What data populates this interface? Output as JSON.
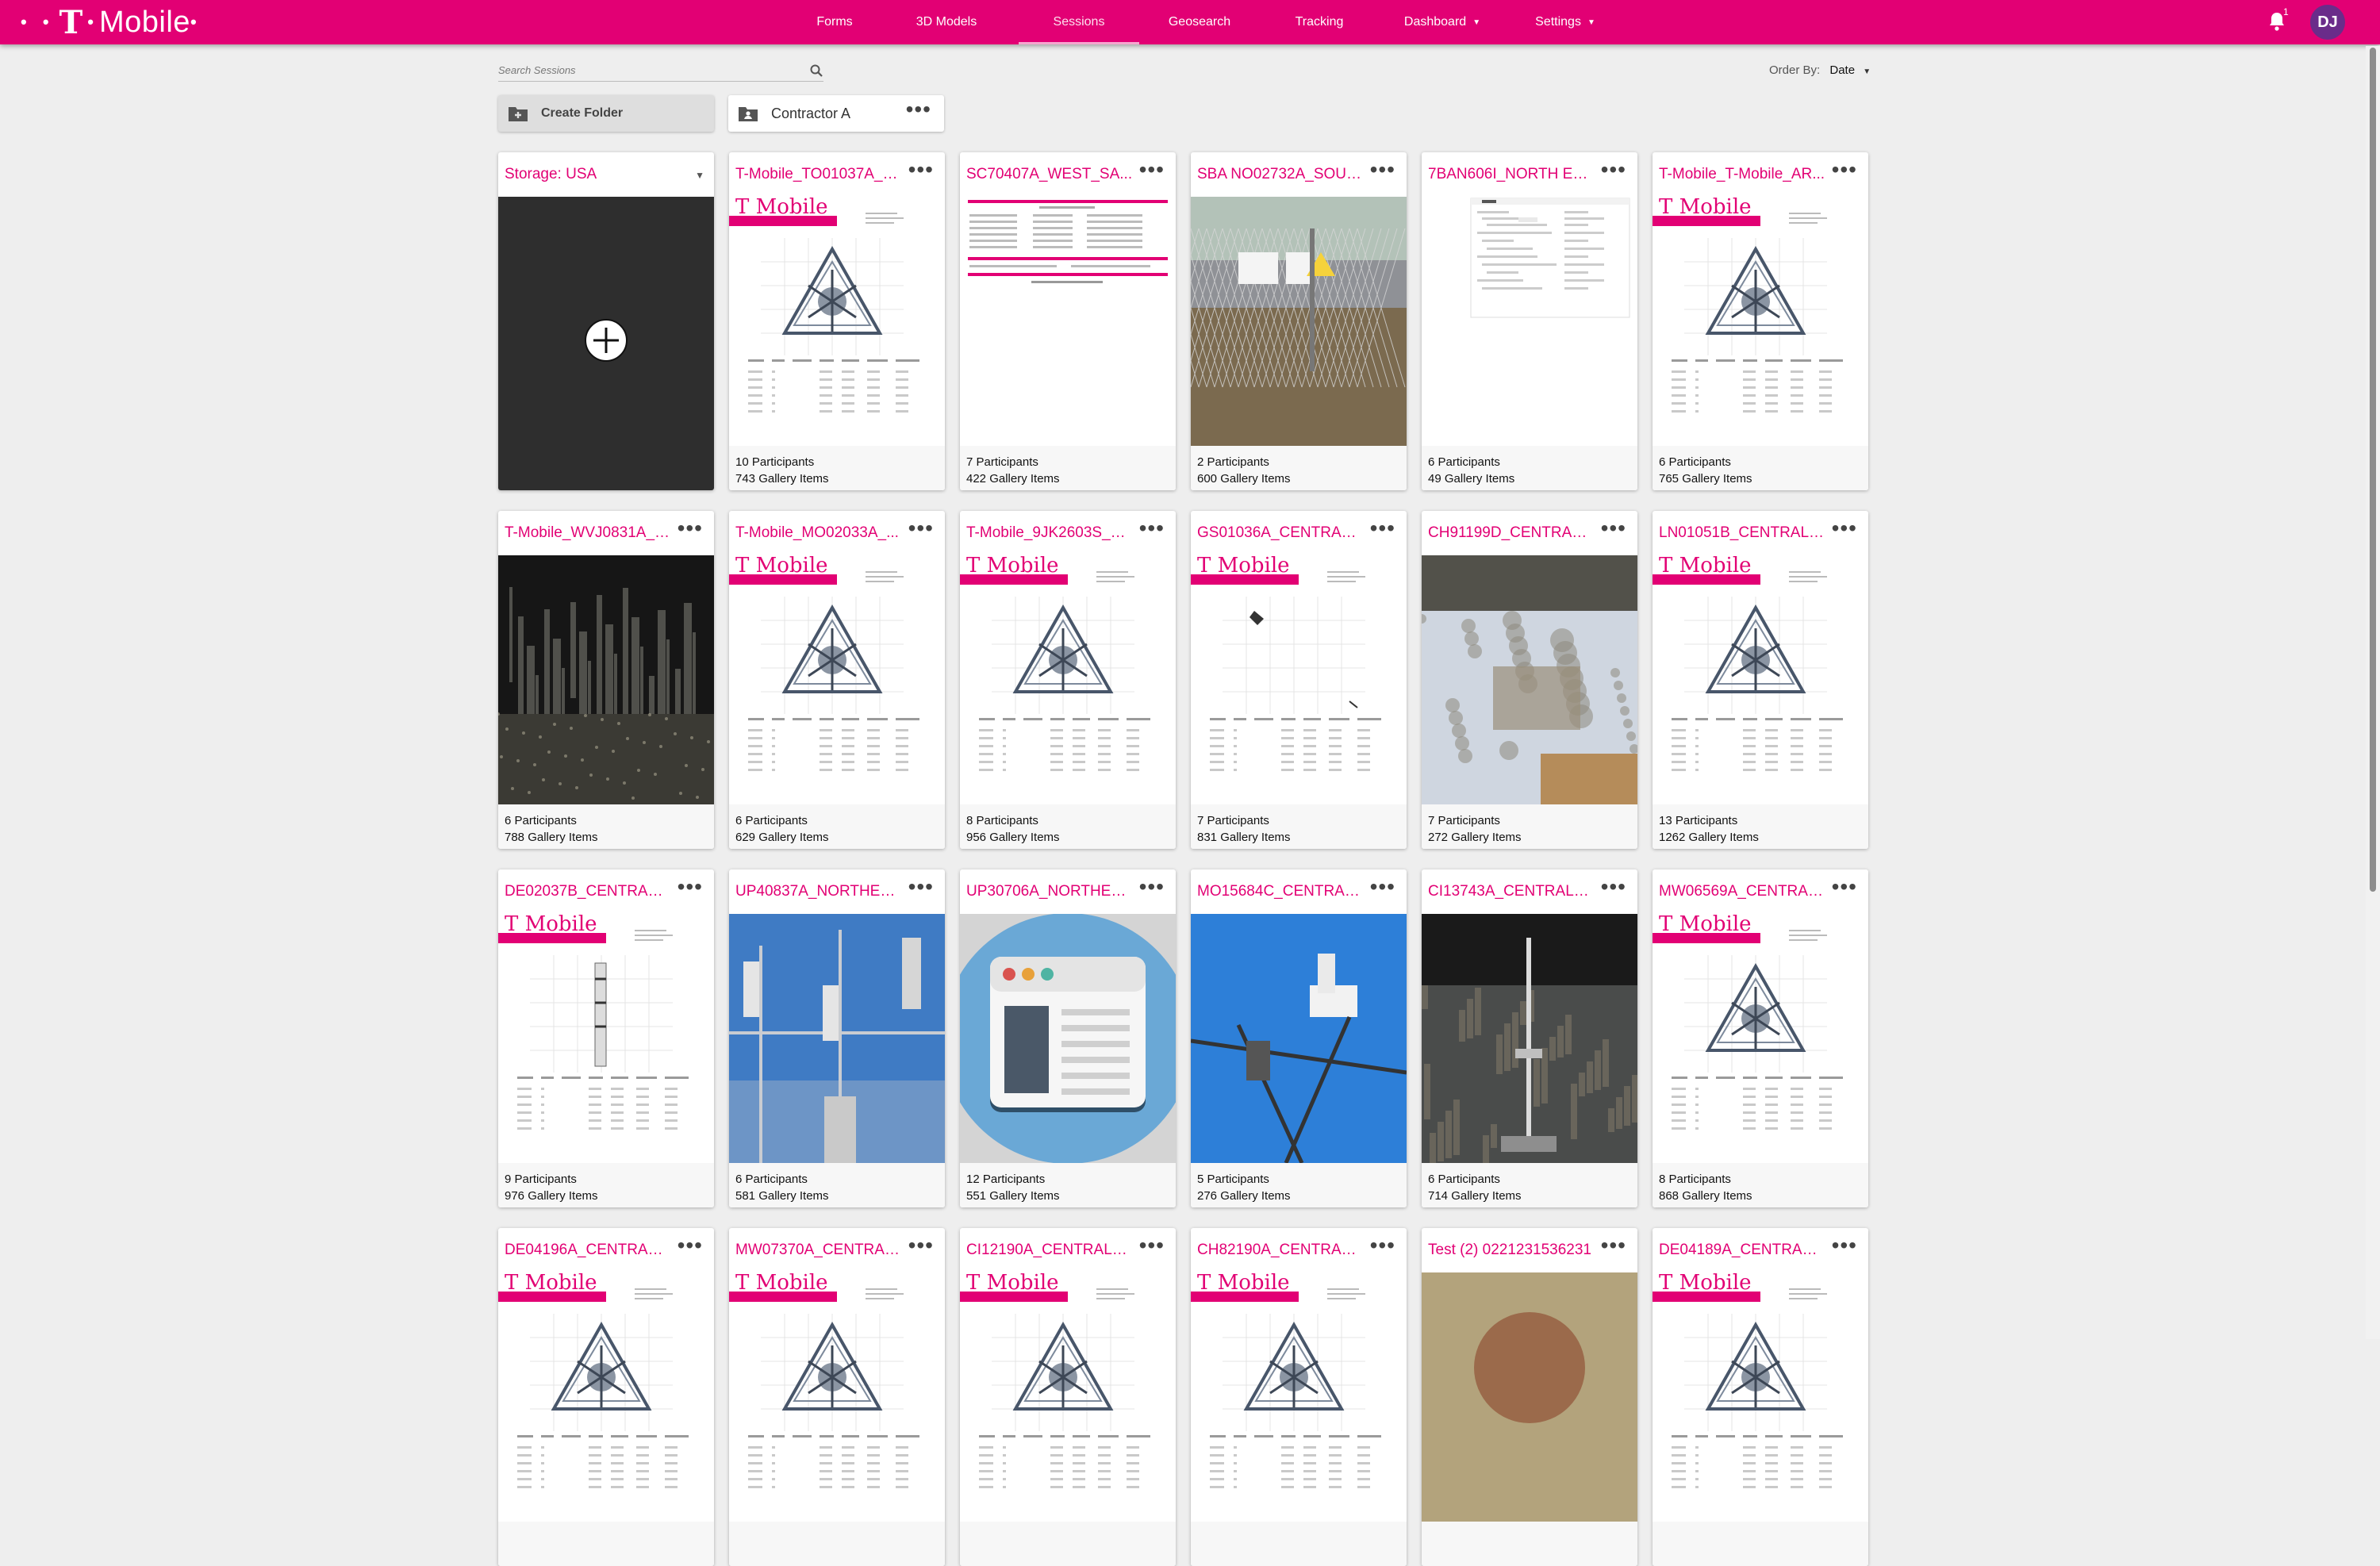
{
  "brand": {
    "dots": "• • ",
    "t": "T",
    "sep": " •",
    "word": "Mobile",
    "after": "•"
  },
  "nav": {
    "items": [
      {
        "label": "Forms"
      },
      {
        "label": "3D Models"
      },
      {
        "label": "Sessions"
      },
      {
        "label": "Geosearch"
      },
      {
        "label": "Tracking"
      },
      {
        "label": "Dashboard"
      },
      {
        "label": "Settings"
      }
    ],
    "active": "Sessions",
    "notification_count": "1",
    "avatar_initials": "DJ"
  },
  "toolbar": {
    "search_placeholder": "Search Sessions",
    "order_label": "Order By:",
    "order_value": "Date",
    "create_folder_label": "Create Folder",
    "folder_name": "Contractor A"
  },
  "storage": {
    "label": "Storage: USA"
  },
  "sessions": [
    {
      "title": "T-Mobile_TO01037A_C...",
      "participants": "10 Participants",
      "gallery": "743 Gallery Items",
      "thumb": "doc-plan"
    },
    {
      "title": "SC70407A_WEST_SA...",
      "participants": "7 Participants",
      "gallery": "422 Gallery Items",
      "thumb": "form"
    },
    {
      "title": "SBA NO02732A_SOUT...",
      "participants": "2 Participants",
      "gallery": "600 Gallery Items",
      "thumb": "photo-fence"
    },
    {
      "title": "7BAN606I_NORTH EA...",
      "participants": "6 Participants",
      "gallery": "49 Gallery Items",
      "thumb": "screenshot"
    },
    {
      "title": "T-Mobile_T-Mobile_AR...",
      "participants": "6 Participants",
      "gallery": "765 Gallery Items",
      "thumb": "doc-plan"
    },
    {
      "title": "T-Mobile_WVJ0831A_C...",
      "participants": "6 Participants",
      "gallery": "788 Gallery Items",
      "thumb": "photo-pointcloud"
    },
    {
      "title": "T-Mobile_MO02033A_...",
      "participants": "6 Participants",
      "gallery": "629 Gallery Items",
      "thumb": "doc-plan"
    },
    {
      "title": "T-Mobile_9JK2603S_S...",
      "participants": "8 Participants",
      "gallery": "956 Gallery Items",
      "thumb": "doc-plan"
    },
    {
      "title": "GS01036A_CENTRAL_...",
      "participants": "7 Participants",
      "gallery": "831 Gallery Items",
      "thumb": "doc-grid"
    },
    {
      "title": "CH91199D_CENTRAL_...",
      "participants": "7 Participants",
      "gallery": "272 Gallery Items",
      "thumb": "photo-aerial"
    },
    {
      "title": "LN01051B_CENTRAL_...",
      "participants": "13 Participants",
      "gallery": "1262 Gallery Items",
      "thumb": "doc-plan"
    },
    {
      "title": "DE02037B_CENTRAL_...",
      "participants": "9 Participants",
      "gallery": "976 Gallery Items",
      "thumb": "doc-pole"
    },
    {
      "title": "UP40837A_NORTHEA...",
      "participants": "6 Participants",
      "gallery": "581 Gallery Items",
      "thumb": "photo-tower"
    },
    {
      "title": "UP30706A_NORTHEA...",
      "participants": "12 Participants",
      "gallery": "551 Gallery Items",
      "thumb": "placeholder"
    },
    {
      "title": "MO15684C_CENTRAL...",
      "participants": "5 Participants",
      "gallery": "276 Gallery Items",
      "thumb": "photo-antenna"
    },
    {
      "title": "CI13743A_CENTRAL_...",
      "participants": "6 Participants",
      "gallery": "714 Gallery Items",
      "thumb": "photo-pole"
    },
    {
      "title": "MW06569A_CENTRAL...",
      "participants": "8 Participants",
      "gallery": "868 Gallery Items",
      "thumb": "doc-plan"
    },
    {
      "title": "DE04196A_CENTRAL_...",
      "participants": "",
      "gallery": "",
      "thumb": "doc-plan"
    },
    {
      "title": "MW07370A_CENTRAL...",
      "participants": "",
      "gallery": "",
      "thumb": "doc-plan"
    },
    {
      "title": "CI12190A_CENTRAL_...",
      "participants": "",
      "gallery": "",
      "thumb": "doc-plan"
    },
    {
      "title": "CH82190A_CENTRAL_...",
      "participants": "",
      "gallery": "",
      "thumb": "doc-plan"
    },
    {
      "title": "Test (2) 0221231536231",
      "participants": "",
      "gallery": "",
      "thumb": "photo-person"
    },
    {
      "title": "DE04189A_CENTRAL_...",
      "participants": "",
      "gallery": "",
      "thumb": "doc-plan"
    }
  ],
  "thumb_text": {
    "doc_brand": "T Mobile"
  },
  "colors": {
    "brand": "#e20074",
    "avatar": "#6a2c8a",
    "background": "#eeeeee"
  }
}
